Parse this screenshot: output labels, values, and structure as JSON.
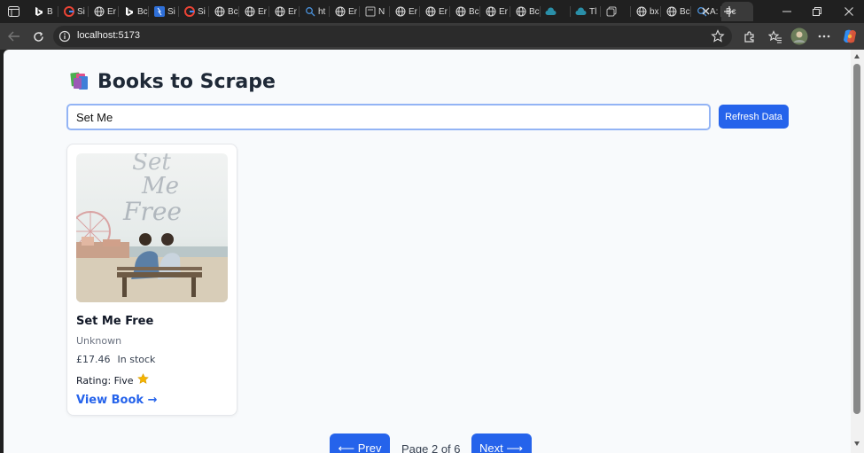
{
  "browser": {
    "tabs": [
      {
        "label": "B",
        "icon": "bing-icon"
      },
      {
        "label": "Si",
        "icon": "google-icon"
      },
      {
        "label": "Er",
        "icon": "globe-icon"
      },
      {
        "label": "Bc",
        "icon": "bing-icon"
      },
      {
        "label": "Si",
        "icon": "blue-app-icon"
      },
      {
        "label": "Si",
        "icon": "google-icon"
      },
      {
        "label": "Bc",
        "icon": "globe-icon"
      },
      {
        "label": "Er",
        "icon": "globe-icon"
      },
      {
        "label": "Er",
        "icon": "globe-icon"
      },
      {
        "label": "ht",
        "icon": "search-icon"
      },
      {
        "label": "Er",
        "icon": "globe-icon"
      },
      {
        "label": "N",
        "icon": "page-icon"
      },
      {
        "label": "Er",
        "icon": "globe-icon"
      },
      {
        "label": "Er",
        "icon": "globe-icon"
      },
      {
        "label": "Bc",
        "icon": "globe-icon"
      },
      {
        "label": "Er",
        "icon": "globe-icon"
      },
      {
        "label": "Bc",
        "icon": "globe-icon"
      },
      {
        "label": "",
        "icon": "cloud-icon"
      },
      {
        "label": "Tl",
        "icon": "cloud-icon"
      },
      {
        "label": "",
        "icon": "copy-icon"
      },
      {
        "label": "bx",
        "icon": "globe-icon"
      },
      {
        "label": "Bc",
        "icon": "globe-icon"
      },
      {
        "label": "A:",
        "icon": "search-icon"
      },
      {
        "label": "Bc",
        "icon": "none",
        "active": true
      }
    ],
    "url": "localhost:5173",
    "accent": "#2563eb"
  },
  "page": {
    "title": "Books to Scrape",
    "search": {
      "value": "Set Me",
      "placeholder": ""
    },
    "refresh_label": "Refresh Data",
    "book": {
      "title": "Set Me Free",
      "cover_text": "Set Me Free",
      "author": "Unknown",
      "price": "£17.46",
      "availability": "In stock",
      "rating_label": "Rating: Five",
      "rating_icon": "star-icon",
      "link_label": "View Book →"
    },
    "pagination": {
      "prev_label": "⟵ Prev",
      "info": "Page 2 of 6",
      "next_label": "Next ⟶"
    }
  }
}
